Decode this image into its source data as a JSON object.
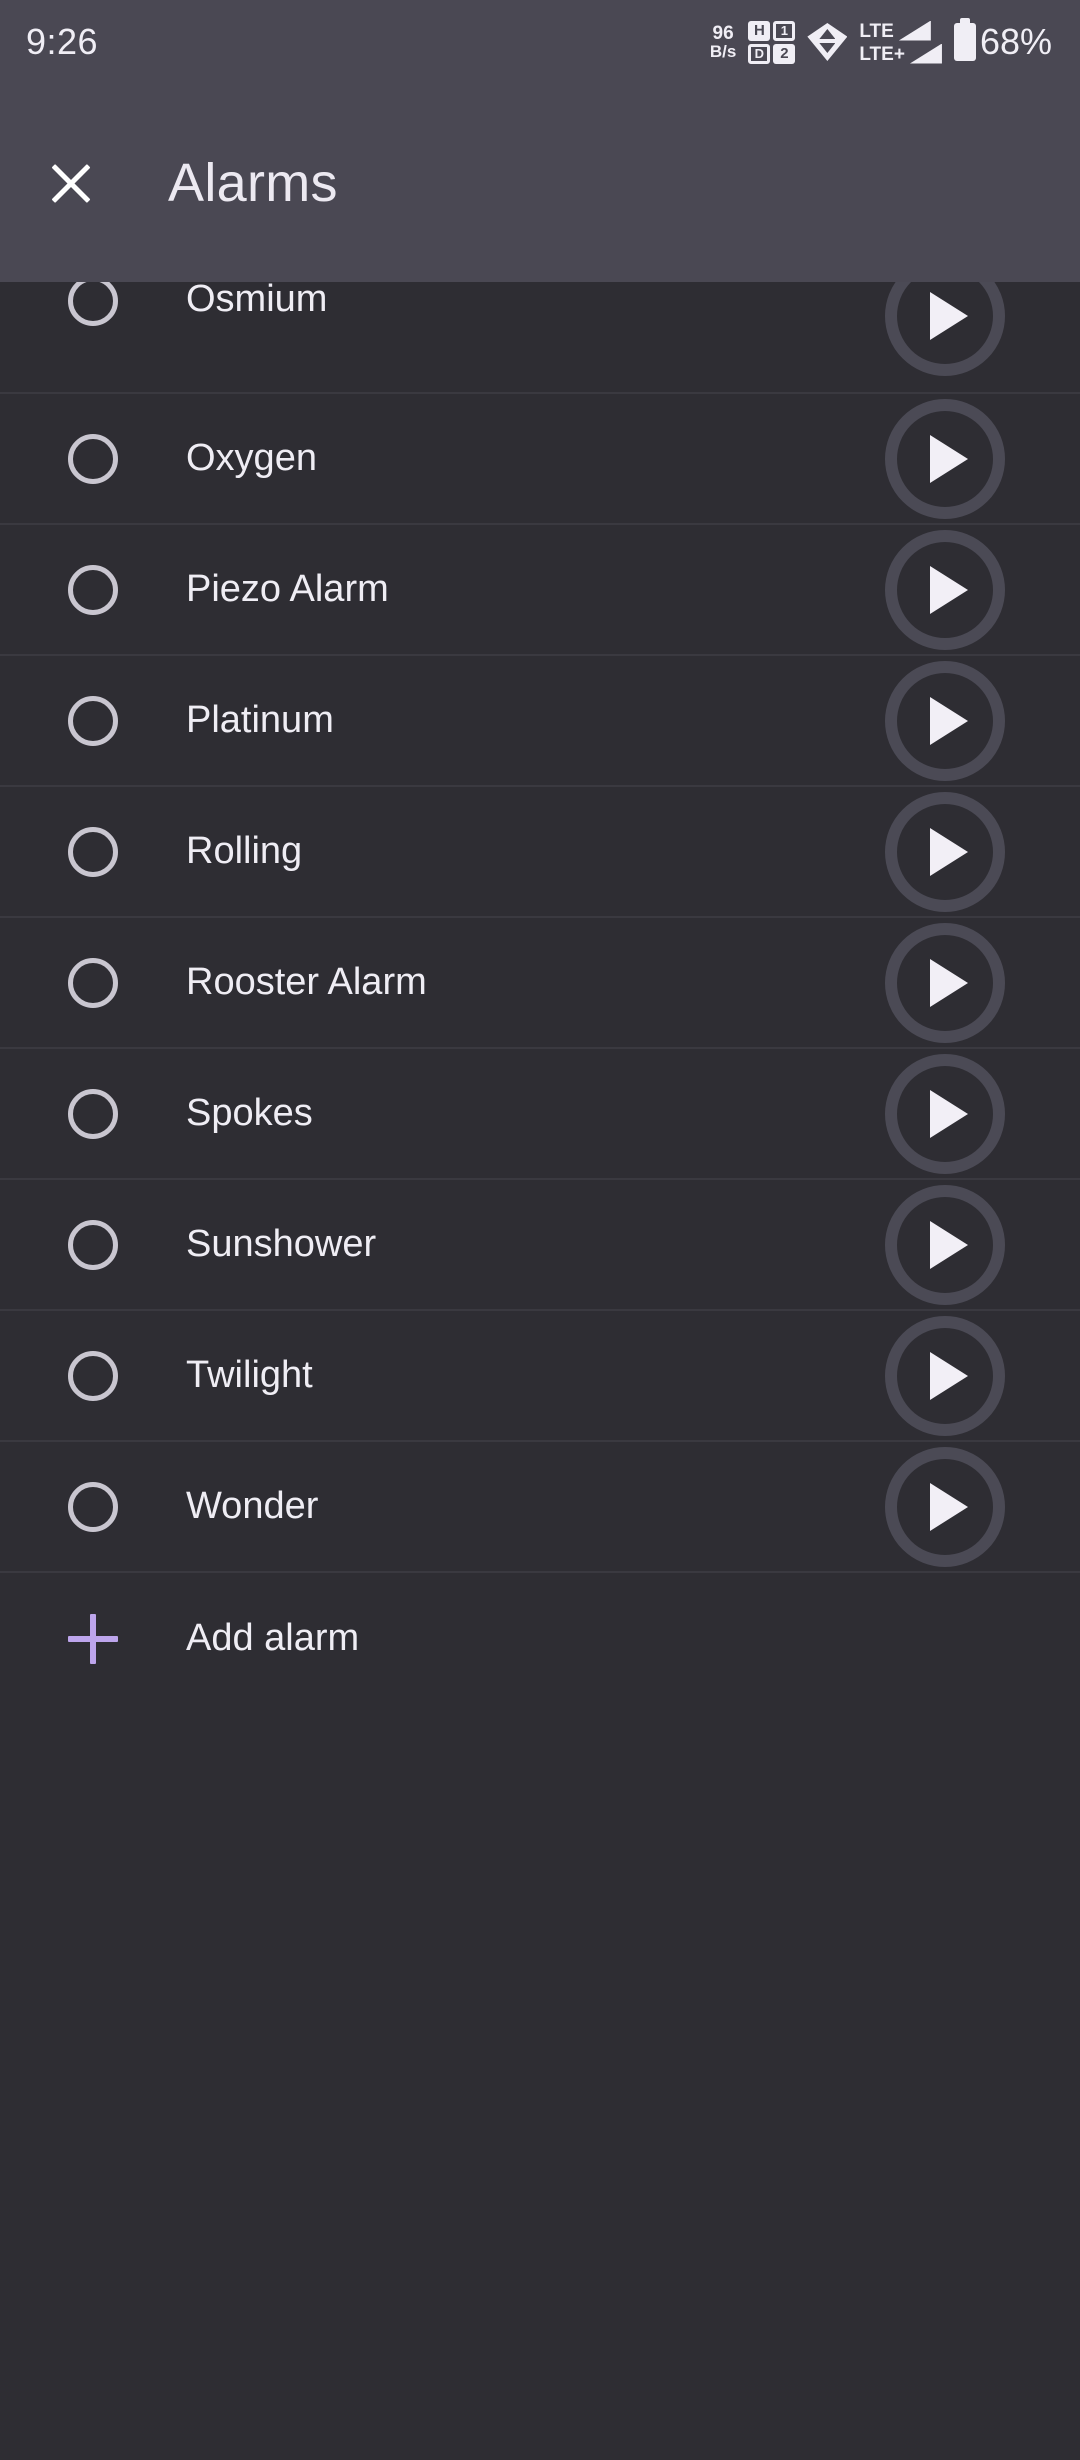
{
  "statusbar": {
    "time": "9:26",
    "network_speed_value": "96",
    "network_speed_unit": "B/s",
    "sim_icon_labels": [
      "H",
      "1",
      "D",
      "2"
    ],
    "wifi_icon": "wifi-updown-icon",
    "signal_primary_label": "LTE",
    "signal_secondary_label": "LTE+",
    "battery_percent": "68%"
  },
  "appbar": {
    "close_icon": "close-icon",
    "title": "Alarms"
  },
  "list": {
    "items": [
      {
        "label": "Osmium",
        "selected": false,
        "clipped": true
      },
      {
        "label": "Oxygen",
        "selected": false,
        "clipped": false
      },
      {
        "label": "Piezo Alarm",
        "selected": false,
        "clipped": false
      },
      {
        "label": "Platinum",
        "selected": false,
        "clipped": false
      },
      {
        "label": "Rolling",
        "selected": false,
        "clipped": false
      },
      {
        "label": "Rooster Alarm",
        "selected": false,
        "clipped": false
      },
      {
        "label": "Spokes",
        "selected": false,
        "clipped": false
      },
      {
        "label": "Sunshower",
        "selected": false,
        "clipped": false
      },
      {
        "label": "Twilight",
        "selected": false,
        "clipped": false
      },
      {
        "label": "Wonder",
        "selected": false,
        "clipped": false
      }
    ],
    "play_icon": "play-icon",
    "radio_icon": "radio-unchecked-icon"
  },
  "add_alarm": {
    "icon": "plus-icon",
    "label": "Add alarm"
  },
  "colors": {
    "appbar_background": "#4a4853",
    "list_background": "#2e2d33",
    "divider": "#3a3940",
    "text_primary": "#efedf4",
    "accent": "#bda5ec",
    "play_ring": "#4b4a55",
    "radio_stroke": "#c9c6d0"
  }
}
